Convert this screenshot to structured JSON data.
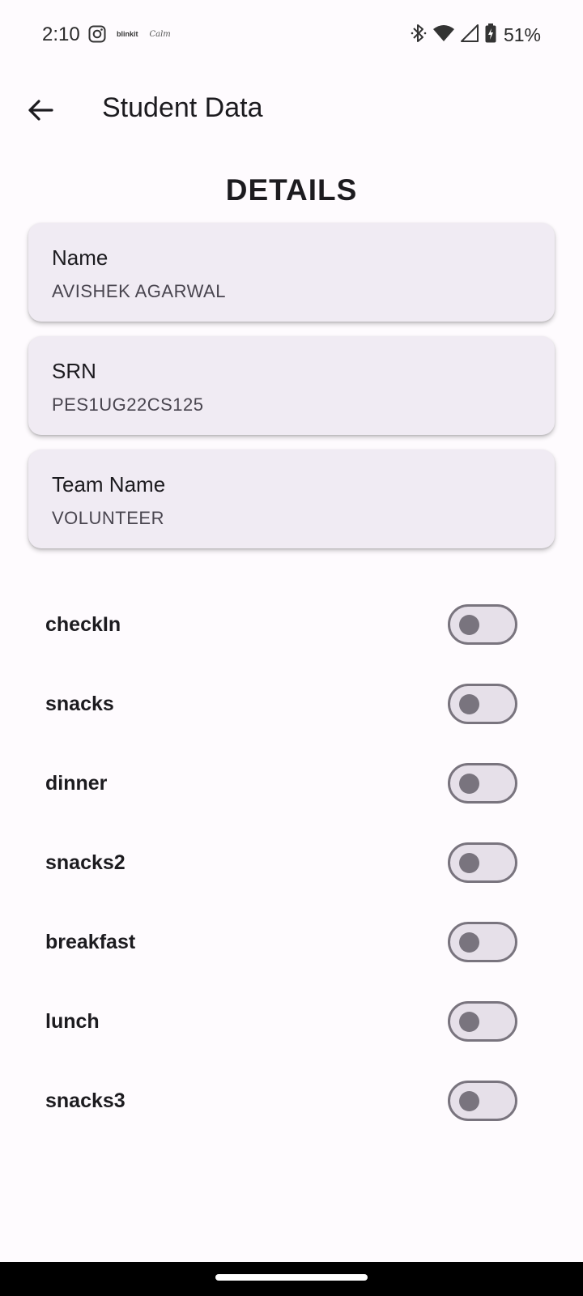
{
  "status_bar": {
    "time": "2:10",
    "app_icon_1": "instagram-icon",
    "app_label_1": "blinkit",
    "app_label_2": "Calm",
    "battery_percent": "51%"
  },
  "app_bar": {
    "title": "Student Data",
    "back_icon": "arrow-left-icon"
  },
  "details": {
    "heading": "DETAILS",
    "cards": [
      {
        "label": "Name",
        "value": "AVISHEK AGARWAL"
      },
      {
        "label": "SRN",
        "value": "PES1UG22CS125"
      },
      {
        "label": "Team Name",
        "value": "VOLUNTEER"
      }
    ]
  },
  "toggles": [
    {
      "label": "checkIn",
      "checked": false
    },
    {
      "label": "snacks",
      "checked": false
    },
    {
      "label": "dinner",
      "checked": false
    },
    {
      "label": "snacks2",
      "checked": false
    },
    {
      "label": "breakfast",
      "checked": false
    },
    {
      "label": "lunch",
      "checked": false
    },
    {
      "label": "snacks3",
      "checked": false
    }
  ],
  "colors": {
    "background": "#fefbfe",
    "card": "#f0ebf3",
    "switch_track": "#e6e0e9",
    "switch_outline": "#79747e",
    "text_primary": "#1c1b1f",
    "text_secondary": "#49454f"
  }
}
